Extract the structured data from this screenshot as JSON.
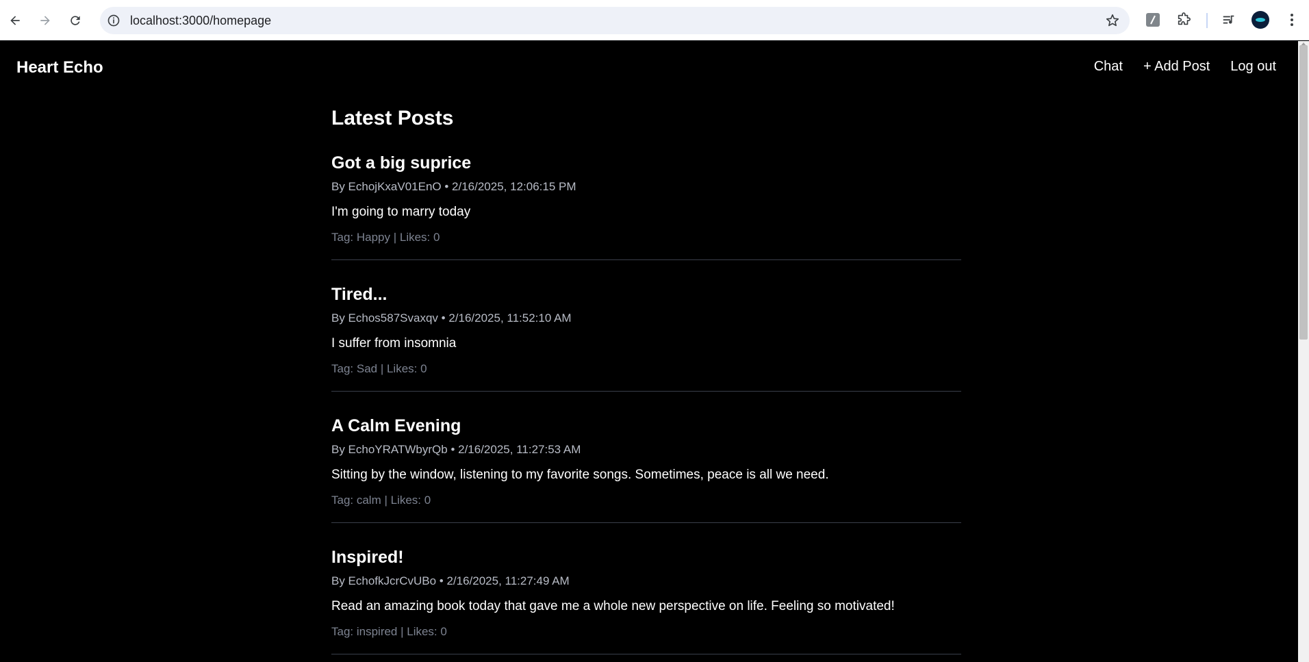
{
  "browser": {
    "url": "localhost:3000/homepage"
  },
  "site": {
    "brand": "Heart Echo",
    "nav": [
      {
        "label": "Chat"
      },
      {
        "label": "+ Add Post"
      },
      {
        "label": "Log out"
      }
    ]
  },
  "main": {
    "heading": "Latest Posts",
    "posts": [
      {
        "title": "Got a big suprice",
        "meta": "By EchojKxaV01EnO • 2/16/2025, 12:06:15 PM",
        "body": "I'm going to marry today",
        "foot": "Tag: Happy | Likes: 0"
      },
      {
        "title": "Tired...",
        "meta": "By Echos587Svaxqv • 2/16/2025, 11:52:10 AM",
        "body": "I suffer from insomnia",
        "foot": "Tag: Sad | Likes: 0"
      },
      {
        "title": "A Calm Evening",
        "meta": "By EchoYRATWbyrQb • 2/16/2025, 11:27:53 AM",
        "body": "Sitting by the window, listening to my favorite songs. Sometimes, peace is all we need.",
        "foot": "Tag: calm | Likes: 0"
      },
      {
        "title": "Inspired!",
        "meta": "By EchofkJcrCvUBo • 2/16/2025, 11:27:49 AM",
        "body": "Read an amazing book today that gave me a whole new perspective on life. Feeling so motivated!",
        "foot": "Tag: inspired | Likes: 0"
      }
    ]
  }
}
